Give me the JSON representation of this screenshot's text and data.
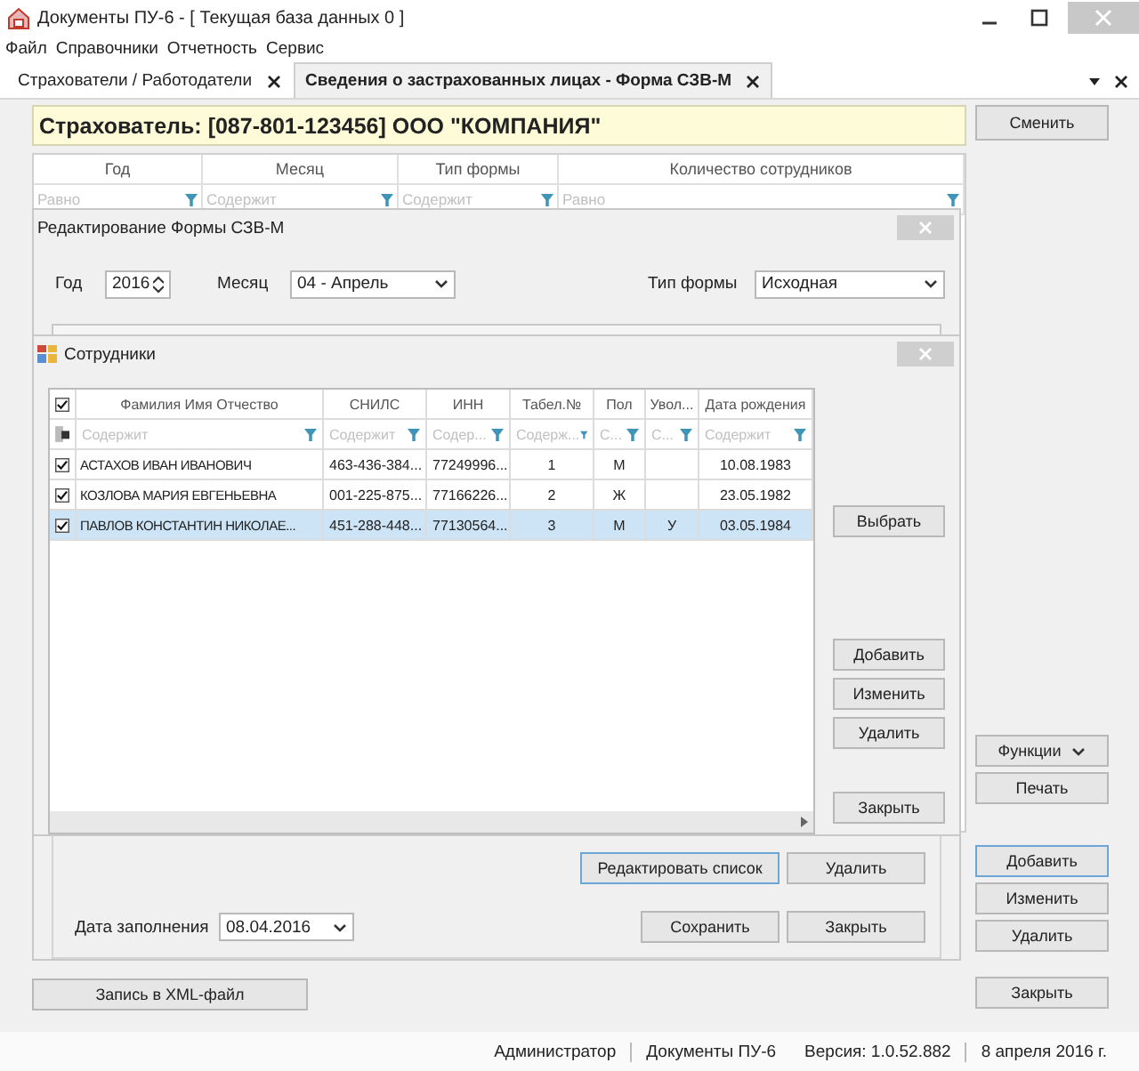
{
  "window": {
    "title": "Документы ПУ-6  -  [ Текущая база данных 0 ]"
  },
  "menu": [
    "Файл",
    "Справочники",
    "Отчетность",
    "Сервис"
  ],
  "tabs": [
    {
      "label": "Страхователи / Работодатели",
      "selected": false
    },
    {
      "label": "Сведения о застрахованных лицах - Форма СЗВ-М",
      "selected": true
    }
  ],
  "insurer_banner": "Страхователь: [087-801-123456]  ООО \"КОМПАНИЯ\"",
  "change_button": "Сменить",
  "forms_table": {
    "columns": [
      {
        "label": "Год",
        "filter": "Равно"
      },
      {
        "label": "Месяц",
        "filter": "Содержит"
      },
      {
        "label": "Тип формы",
        "filter": "Содержит"
      },
      {
        "label": "Количество сотрудников",
        "filter": "Равно"
      }
    ]
  },
  "side_buttons": [
    {
      "label": "Функции",
      "kind": "dropdown",
      "focused": false
    },
    {
      "label": "Печать",
      "kind": "button",
      "focused": false
    },
    {
      "label": "Добавить",
      "kind": "button",
      "focused": true
    },
    {
      "label": "Изменить",
      "kind": "button",
      "focused": false
    },
    {
      "label": "Удалить",
      "kind": "button",
      "focused": false
    },
    {
      "label": "Закрыть",
      "kind": "button",
      "focused": false
    }
  ],
  "xml_button": "Запись в XML-файл",
  "edit_dialog": {
    "title": "Редактирование Формы СЗВ-М",
    "year_label": "Год",
    "year": "2016",
    "month_label": "Месяц",
    "month": "04 - Апрель",
    "form_type_label": "Тип формы",
    "form_type": "Исходная",
    "list_buttons": [
      {
        "label": "Редактировать список",
        "focused": true
      },
      {
        "label": "Удалить",
        "focused": false
      }
    ],
    "date_label": "Дата заполнения",
    "date": "08.04.2016",
    "buttons": [
      {
        "label": "Сохранить",
        "focused": false
      },
      {
        "label": "Закрыть",
        "focused": false
      }
    ]
  },
  "employees_dialog": {
    "title": "Сотрудники",
    "select_all": true,
    "columns": [
      {
        "label": "Фамилия Имя Отчество",
        "filter": "Содержит"
      },
      {
        "label": "СНИЛС",
        "filter": "Содержит"
      },
      {
        "label": "ИНН",
        "filter": "Содер..."
      },
      {
        "label": "Табел.№",
        "filter": "Содерж..."
      },
      {
        "label": "Пол",
        "filter": "С..."
      },
      {
        "label": "Увол...",
        "filter": "С..."
      },
      {
        "label": "Дата рождения",
        "filter": "Содержит"
      }
    ],
    "rows": [
      {
        "checked": true,
        "selected": false,
        "cells": [
          "АСТАХОВ ИВАН ИВАНОВИЧ",
          "463-436-384...",
          "77249996...",
          "1",
          "М",
          "",
          "10.08.1983"
        ]
      },
      {
        "checked": true,
        "selected": false,
        "cells": [
          "КОЗЛОВА МАРИЯ ЕВГЕНЬЕВНА",
          "001-225-875...",
          "77166226...",
          "2",
          "Ж",
          "",
          "23.05.1982"
        ]
      },
      {
        "checked": true,
        "selected": true,
        "cells": [
          "ПАВЛОВ  КОНСТАНТИН  НИКОЛАЕ...",
          "451-288-448...",
          "77130564...",
          "3",
          "М",
          "У",
          "03.05.1984"
        ]
      }
    ],
    "buttons": [
      "Выбрать",
      "Добавить",
      "Изменить",
      "Удалить",
      "Закрыть"
    ]
  },
  "status_bar": [
    "Администратор",
    "Документы ПУ-6",
    "Версия: 1.0.52.882",
    "8 апреля 2016 г."
  ]
}
